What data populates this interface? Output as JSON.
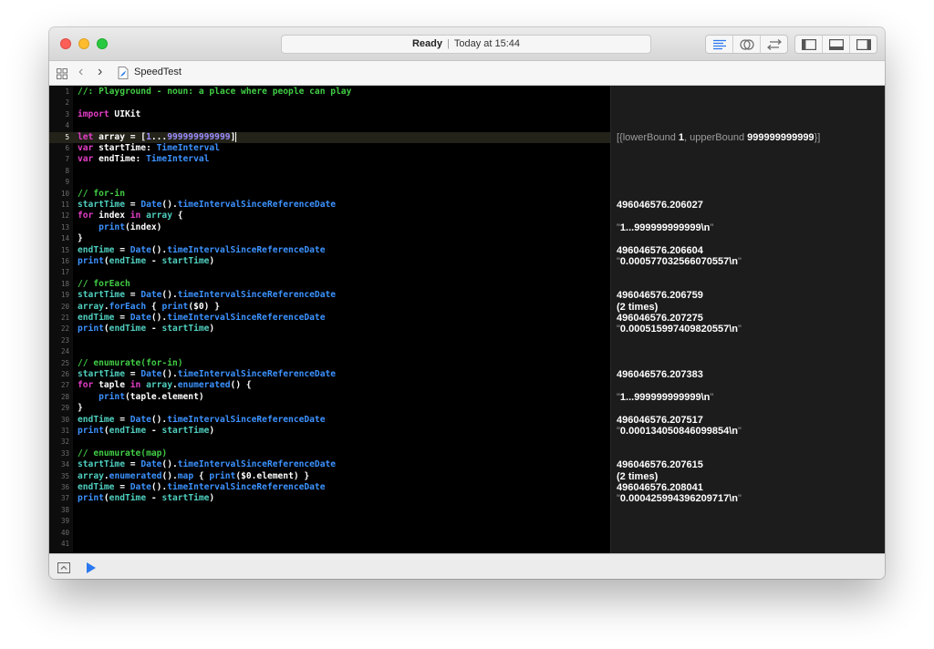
{
  "window": {
    "status": {
      "state": "Ready",
      "time": "Today at 15:44"
    }
  },
  "toolbar": {
    "editor_modes": [
      "standard-editor-icon",
      "assistant-editor-icon",
      "version-editor-icon"
    ],
    "panels": [
      "navigator-panel-icon",
      "debug-panel-icon",
      "utilities-panel-icon"
    ]
  },
  "navbar": {
    "filename": "SpeedTest"
  },
  "editor": {
    "current_line": 5,
    "lines": [
      {
        "n": "1",
        "t": [
          [
            "//: Playground - noun: a place where people can play",
            "cm"
          ]
        ]
      },
      {
        "n": "2",
        "t": []
      },
      {
        "n": "3",
        "t": [
          [
            "import",
            "kw"
          ],
          [
            " UIKit",
            "pl"
          ]
        ]
      },
      {
        "n": "4",
        "t": []
      },
      {
        "n": "5",
        "t": [
          [
            "let",
            "kw"
          ],
          [
            " array = [",
            "pl"
          ],
          [
            "1",
            "num"
          ],
          [
            "...",
            "pl"
          ],
          [
            "999999999999",
            "num"
          ],
          [
            "]",
            "cursor"
          ]
        ]
      },
      {
        "n": "6",
        "t": [
          [
            "var",
            "kw"
          ],
          [
            " startTime: ",
            "pl"
          ],
          [
            "TimeInterval",
            "ty"
          ]
        ]
      },
      {
        "n": "7",
        "t": [
          [
            "var",
            "kw"
          ],
          [
            " endTime: ",
            "pl"
          ],
          [
            "TimeInterval",
            "ty"
          ]
        ]
      },
      {
        "n": "8",
        "t": []
      },
      {
        "n": "9",
        "t": []
      },
      {
        "n": "10",
        "t": [
          [
            "// for-in",
            "cm"
          ]
        ]
      },
      {
        "n": "11",
        "t": [
          [
            "startTime",
            "var"
          ],
          [
            " = ",
            "pl"
          ],
          [
            "Date",
            "ty"
          ],
          [
            "().",
            "pl"
          ],
          [
            "timeIntervalSinceReferenceDate",
            "fn"
          ]
        ]
      },
      {
        "n": "12",
        "t": [
          [
            "for",
            "kw"
          ],
          [
            " index ",
            "pl"
          ],
          [
            "in",
            "kw"
          ],
          [
            " ",
            "pl"
          ],
          [
            "array",
            "var"
          ],
          [
            " {",
            "pl"
          ]
        ]
      },
      {
        "n": "13",
        "t": [
          [
            "    ",
            "pl"
          ],
          [
            "print",
            "fn"
          ],
          [
            "(index)",
            "pl"
          ]
        ]
      },
      {
        "n": "14",
        "t": [
          [
            "}",
            "pl"
          ]
        ]
      },
      {
        "n": "15",
        "t": [
          [
            "endTime",
            "var"
          ],
          [
            " = ",
            "pl"
          ],
          [
            "Date",
            "ty"
          ],
          [
            "().",
            "pl"
          ],
          [
            "timeIntervalSinceReferenceDate",
            "fn"
          ]
        ]
      },
      {
        "n": "16",
        "t": [
          [
            "print",
            "fn"
          ],
          [
            "(",
            "pl"
          ],
          [
            "endTime",
            "var"
          ],
          [
            " - ",
            "pl"
          ],
          [
            "startTime",
            "var"
          ],
          [
            ")",
            "pl"
          ]
        ]
      },
      {
        "n": "17",
        "t": []
      },
      {
        "n": "18",
        "t": [
          [
            "// forEach",
            "cm"
          ]
        ]
      },
      {
        "n": "19",
        "t": [
          [
            "startTime",
            "var"
          ],
          [
            " = ",
            "pl"
          ],
          [
            "Date",
            "ty"
          ],
          [
            "().",
            "pl"
          ],
          [
            "timeIntervalSinceReferenceDate",
            "fn"
          ]
        ]
      },
      {
        "n": "20",
        "t": [
          [
            "array",
            "var"
          ],
          [
            ".",
            "pl"
          ],
          [
            "forEach",
            "fn"
          ],
          [
            " { ",
            "pl"
          ],
          [
            "print",
            "fn"
          ],
          [
            "($0) }",
            "pl"
          ]
        ]
      },
      {
        "n": "21",
        "t": [
          [
            "endTime",
            "var"
          ],
          [
            " = ",
            "pl"
          ],
          [
            "Date",
            "ty"
          ],
          [
            "().",
            "pl"
          ],
          [
            "timeIntervalSinceReferenceDate",
            "fn"
          ]
        ]
      },
      {
        "n": "22",
        "t": [
          [
            "print",
            "fn"
          ],
          [
            "(",
            "pl"
          ],
          [
            "endTime",
            "var"
          ],
          [
            " - ",
            "pl"
          ],
          [
            "startTime",
            "var"
          ],
          [
            ")",
            "pl"
          ]
        ]
      },
      {
        "n": "23",
        "t": []
      },
      {
        "n": "24",
        "t": []
      },
      {
        "n": "25",
        "t": [
          [
            "// enumurate(for-in)",
            "cm"
          ]
        ]
      },
      {
        "n": "26",
        "t": [
          [
            "startTime",
            "var"
          ],
          [
            " = ",
            "pl"
          ],
          [
            "Date",
            "ty"
          ],
          [
            "().",
            "pl"
          ],
          [
            "timeIntervalSinceReferenceDate",
            "fn"
          ]
        ]
      },
      {
        "n": "27",
        "t": [
          [
            "for",
            "kw"
          ],
          [
            " taple ",
            "pl"
          ],
          [
            "in",
            "kw"
          ],
          [
            " ",
            "pl"
          ],
          [
            "array",
            "var"
          ],
          [
            ".",
            "pl"
          ],
          [
            "enumerated",
            "fn"
          ],
          [
            "() {",
            "pl"
          ]
        ]
      },
      {
        "n": "28",
        "t": [
          [
            "    ",
            "pl"
          ],
          [
            "print",
            "fn"
          ],
          [
            "(taple.element)",
            "pl"
          ]
        ]
      },
      {
        "n": "29",
        "t": [
          [
            "}",
            "pl"
          ]
        ]
      },
      {
        "n": "30",
        "t": [
          [
            "endTime",
            "var"
          ],
          [
            " = ",
            "pl"
          ],
          [
            "Date",
            "ty"
          ],
          [
            "().",
            "pl"
          ],
          [
            "timeIntervalSinceReferenceDate",
            "fn"
          ]
        ]
      },
      {
        "n": "31",
        "t": [
          [
            "print",
            "fn"
          ],
          [
            "(",
            "pl"
          ],
          [
            "endTime",
            "var"
          ],
          [
            " - ",
            "pl"
          ],
          [
            "startTime",
            "var"
          ],
          [
            ")",
            "pl"
          ]
        ]
      },
      {
        "n": "32",
        "t": []
      },
      {
        "n": "33",
        "t": [
          [
            "// enumurate(map)",
            "cm"
          ]
        ]
      },
      {
        "n": "34",
        "t": [
          [
            "startTime",
            "var"
          ],
          [
            " = ",
            "pl"
          ],
          [
            "Date",
            "ty"
          ],
          [
            "().",
            "pl"
          ],
          [
            "timeIntervalSinceReferenceDate",
            "fn"
          ]
        ]
      },
      {
        "n": "35",
        "t": [
          [
            "array",
            "var"
          ],
          [
            ".",
            "pl"
          ],
          [
            "enumerated",
            "fn"
          ],
          [
            "().",
            "pl"
          ],
          [
            "map",
            "fn"
          ],
          [
            " { ",
            "pl"
          ],
          [
            "print",
            "fn"
          ],
          [
            "($0.element) }",
            "pl"
          ]
        ]
      },
      {
        "n": "36",
        "t": [
          [
            "endTime",
            "var"
          ],
          [
            " = ",
            "pl"
          ],
          [
            "Date",
            "ty"
          ],
          [
            "().",
            "pl"
          ],
          [
            "timeIntervalSinceReferenceDate",
            "fn"
          ]
        ]
      },
      {
        "n": "37",
        "t": [
          [
            "print",
            "fn"
          ],
          [
            "(",
            "pl"
          ],
          [
            "endTime",
            "var"
          ],
          [
            " - ",
            "pl"
          ],
          [
            "startTime",
            "var"
          ],
          [
            ")",
            "pl"
          ]
        ]
      },
      {
        "n": "38",
        "t": []
      },
      {
        "n": "39",
        "t": []
      },
      {
        "n": "40",
        "t": []
      },
      {
        "n": "41",
        "t": []
      }
    ]
  },
  "results": [
    {
      "line": 5,
      "parts": [
        [
          "[{lowerBound ",
          "dim"
        ],
        [
          "1",
          "b"
        ],
        [
          ", upperBound ",
          "dim"
        ],
        [
          "999999999999",
          "b"
        ],
        [
          "}]",
          "dim"
        ]
      ]
    },
    {
      "line": 11,
      "parts": [
        [
          "496046576.206027",
          "b"
        ]
      ]
    },
    {
      "line": 13,
      "parts": [
        [
          "\"",
          "dim"
        ],
        [
          "1...999999999999\\n",
          "b"
        ],
        [
          "\"",
          "dim"
        ]
      ]
    },
    {
      "line": 15,
      "parts": [
        [
          "496046576.206604",
          "b"
        ]
      ]
    },
    {
      "line": 16,
      "parts": [
        [
          "\"",
          "dim"
        ],
        [
          "0.000577032566070557\\n",
          "b"
        ],
        [
          "\"",
          "dim"
        ]
      ]
    },
    {
      "line": 19,
      "parts": [
        [
          "496046576.206759",
          "b"
        ]
      ]
    },
    {
      "line": 20,
      "parts": [
        [
          "(2 times)",
          "b"
        ]
      ]
    },
    {
      "line": 21,
      "parts": [
        [
          "496046576.207275",
          "b"
        ]
      ]
    },
    {
      "line": 22,
      "parts": [
        [
          "\"",
          "dim"
        ],
        [
          "0.000515997409820557\\n",
          "b"
        ],
        [
          "\"",
          "dim"
        ]
      ]
    },
    {
      "line": 26,
      "parts": [
        [
          "496046576.207383",
          "b"
        ]
      ]
    },
    {
      "line": 28,
      "parts": [
        [
          "\"",
          "dim"
        ],
        [
          "1...999999999999\\n",
          "b"
        ],
        [
          "\"",
          "dim"
        ]
      ]
    },
    {
      "line": 30,
      "parts": [
        [
          "496046576.207517",
          "b"
        ]
      ]
    },
    {
      "line": 31,
      "parts": [
        [
          "\"",
          "dim"
        ],
        [
          "0.000134050846099854\\n",
          "b"
        ],
        [
          "\"",
          "dim"
        ]
      ]
    },
    {
      "line": 34,
      "parts": [
        [
          "496046576.207615",
          "b"
        ]
      ]
    },
    {
      "line": 35,
      "parts": [
        [
          "(2 times)",
          "b"
        ]
      ]
    },
    {
      "line": 36,
      "parts": [
        [
          "496046576.208041",
          "b"
        ]
      ]
    },
    {
      "line": 37,
      "parts": [
        [
          "\"",
          "dim"
        ],
        [
          "0.000425994396209717\\n",
          "b"
        ],
        [
          "\"",
          "dim"
        ]
      ]
    }
  ],
  "colors": {
    "keyword": "#e43ec7",
    "comment": "#41cc45",
    "type": "#3c92ff",
    "number": "#9d8eff",
    "variable": "#4fd0c0",
    "editor_background": "#000000",
    "results_background": "#1c1c1c"
  }
}
